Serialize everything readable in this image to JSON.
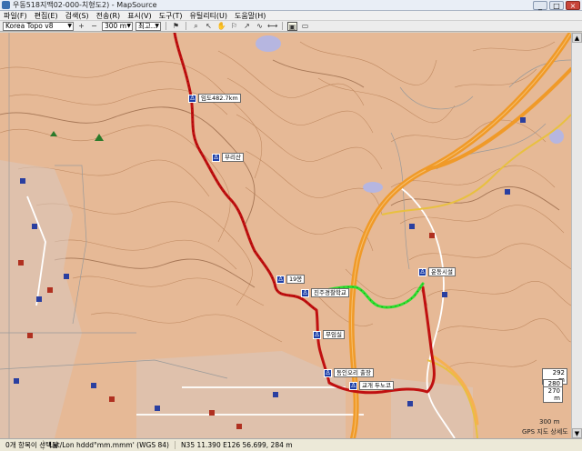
{
  "window": {
    "title": "우동518지맥02-000-치형도2) - MapSource",
    "controls": [
      "_",
      "□",
      "×"
    ]
  },
  "menu": {
    "items": [
      "파일(F)",
      "편집(E)",
      "검색(S)",
      "전송(R)",
      "표시(V)",
      "도구(T)",
      "유틸리티(U)",
      "도움말(H)"
    ]
  },
  "toolbar": {
    "map_product": "Korea Topo v8",
    "zoom_in_icon": "+",
    "zoom_out_icon": "−",
    "zoom_level": "300 m",
    "detail_level": "최고..."
  },
  "map": {
    "waypoints": [
      {
        "label": "임도482.7km"
      },
      {
        "label": "부리산"
      },
      {
        "label": "19봉"
      },
      {
        "label": "진주경찰학교"
      },
      {
        "label": "무임실"
      },
      {
        "label": "동인오리 출장"
      },
      {
        "label": "교개 두노코"
      },
      {
        "label": "운동시설"
      }
    ],
    "scale_labels": [
      "292 m",
      "280 m",
      "270 m",
      "300 m"
    ],
    "gps_caption": "GPS 지도 상세도",
    "colors": {
      "track_red": "#c01010",
      "track_green": "#2fe030",
      "highway": "#f0a030",
      "terrain": "#e6b996",
      "contour": "#b07850"
    }
  },
  "status": {
    "items_selected": "0개 항목이 선택됨",
    "coord_format": "Lat/Lon hddd°mm.mmm' (WGS 84)",
    "cursor_position": "N35 11.390 E126 56.699, 284 m"
  }
}
